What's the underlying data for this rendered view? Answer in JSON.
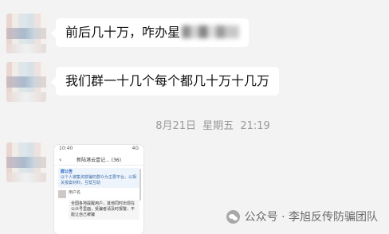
{
  "messages": [
    {
      "type": "text",
      "text": "前后几十万，咋办星",
      "tail_obscured": true
    },
    {
      "type": "text",
      "text": "我们群一十几个每个都几十万十几万"
    }
  ],
  "timestamp": {
    "date": "8月21日",
    "weekday": "星期五",
    "time": "21:19"
  },
  "image_message": {
    "status_time": "10:40",
    "status_icons": "4G",
    "title": "新陆港云壹记... (36)",
    "notice_title": "群公告",
    "notice_text": "以个人被集资欺骗的群众为主要平台，以相关报案材料，互帮互助",
    "member_name": "用户名",
    "body_text": "全国各地提醒用户，其他同时出现在公众号里面，受骗者请及时报警，不能让自己被骗"
  },
  "watermark": {
    "text": "公众号 · 李旭反传防骗团队",
    "icon": "wechat-icon"
  }
}
